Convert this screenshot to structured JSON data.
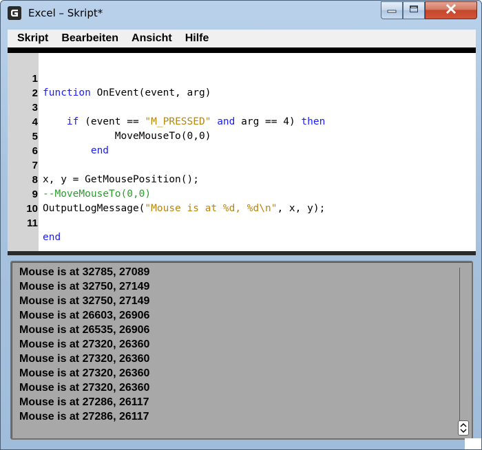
{
  "window": {
    "title": "Excel – Skript*"
  },
  "menu": {
    "items": [
      "Skript",
      "Bearbeiten",
      "Ansicht",
      "Hilfe"
    ]
  },
  "editor": {
    "line_numbers": [
      "1",
      "2",
      "3",
      "4",
      "5",
      "6",
      "7",
      "8",
      "9",
      "10",
      "11"
    ]
  },
  "output": {
    "lines": [
      "Mouse is at 32785, 27089",
      "Mouse is at 32750, 27149",
      "Mouse is at 32750, 27149",
      "Mouse is at 26603, 26906",
      "Mouse is at 26535, 26906",
      "Mouse is at 27320, 26360",
      "Mouse is at 27320, 26360",
      "Mouse is at 27320, 26360",
      "Mouse is at 27320, 26360",
      "Mouse is at 27286, 26117",
      "Mouse is at 27286, 26117"
    ]
  },
  "colors": {
    "keyword": "#1a1aff",
    "string": "#b8860b",
    "comment": "#2e9a2e",
    "output_bg": "#a8a8a8"
  },
  "icons": {
    "app": "logitech-g-icon",
    "minimize": "minimize-icon",
    "maximize": "maximize-icon",
    "close": "close-icon",
    "scroll": "scroll-updown-icon"
  }
}
